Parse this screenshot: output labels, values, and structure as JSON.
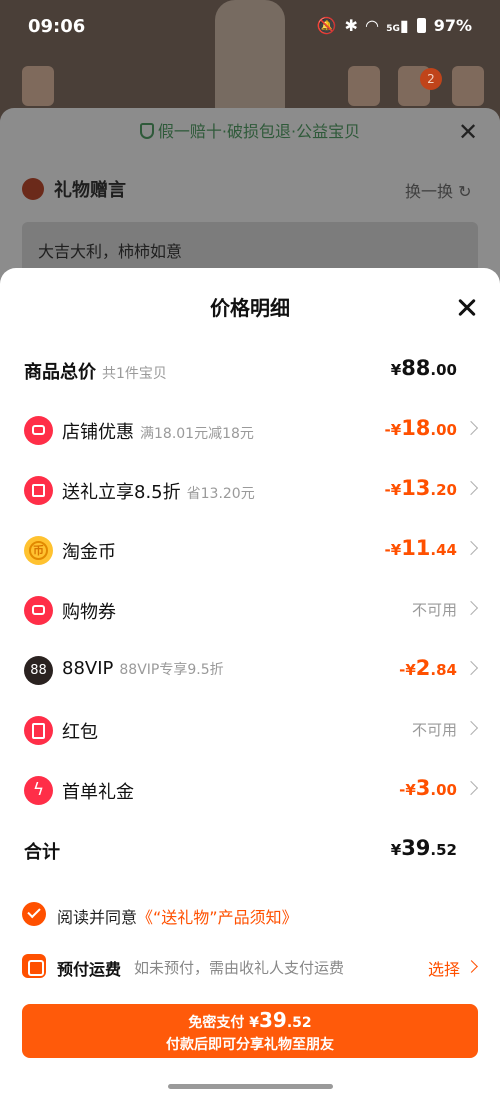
{
  "status_bar": {
    "time": "09:06",
    "network": "5G",
    "battery": "97%"
  },
  "background": {
    "cart_badge": "2",
    "guarantee": "假一赔十·破损包退·公益宝贝",
    "gift_message_title": "礼物赠言",
    "swap_label": "换一换",
    "gift_message": "大吉大利，柿柿如意"
  },
  "sheet": {
    "title": "价格明细",
    "subtotal": {
      "label": "商品总价",
      "sub": "共1件宝贝",
      "currency": "¥",
      "int": "88",
      "dec": ".00"
    },
    "items": [
      {
        "label": "店铺优惠",
        "sub": "满18.01元减18元",
        "prefix": "-¥",
        "int": "18",
        "dec": ".00",
        "icon": "shop-coupon-icon"
      },
      {
        "label": "送礼立享8.5折",
        "sub": "省13.20元",
        "prefix": "-¥",
        "int": "13",
        "dec": ".20",
        "icon": "gift-icon"
      },
      {
        "label": "淘金币",
        "sub": "",
        "prefix": "-¥",
        "int": "11",
        "dec": ".44",
        "icon": "gold-coin-icon"
      },
      {
        "label": "购物券",
        "sub": "",
        "status": "不可用",
        "icon": "shopping-voucher-icon"
      },
      {
        "label": "88VIP",
        "sub": "88VIP专享9.5折",
        "prefix": "-¥",
        "int": "2",
        "dec": ".84",
        "icon": "vip88-icon",
        "icon_text": "88"
      },
      {
        "label": "红包",
        "sub": "",
        "status": "不可用",
        "icon": "red-packet-icon"
      },
      {
        "label": "首单礼金",
        "sub": "",
        "prefix": "-¥",
        "int": "3",
        "dec": ".00",
        "icon": "lightning-icon"
      }
    ],
    "total": {
      "label": "合计",
      "currency": "¥",
      "int": "39",
      "dec": ".52"
    },
    "agreement": {
      "text": "阅读并同意",
      "link": "《“送礼物”产品须知》"
    },
    "prepay": {
      "title": "预付运费",
      "desc": "如未预付，需由收礼人支付运费",
      "action": "选择"
    },
    "pay_button": {
      "label": "免密支付",
      "currency": "¥",
      "int": "39",
      "dec": ".52",
      "subtitle": "付款后即可分享礼物至朋友"
    }
  },
  "colors": {
    "accent": "#ff5000",
    "icon_red": "#ff2e48",
    "gold": "#ffc230"
  }
}
